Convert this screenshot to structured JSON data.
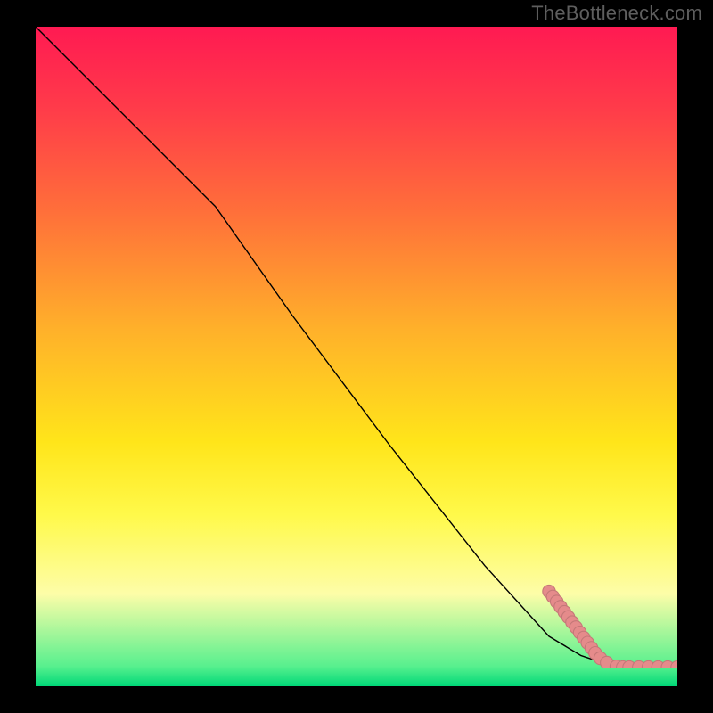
{
  "attribution": "TheBottleneck.com",
  "chart_data": {
    "type": "line",
    "title": "",
    "xlabel": "",
    "ylabel": "",
    "xlim": [
      0,
      100
    ],
    "ylim": [
      0,
      100
    ],
    "series": [
      {
        "name": "curve",
        "x": [
          0,
          10,
          20,
          28,
          40,
          55,
          70,
          80,
          85,
          88,
          92,
          96,
          100
        ],
        "y": [
          100,
          90,
          80,
          72,
          55,
          35,
          16,
          5,
          2,
          1,
          0.4,
          0.2,
          0.1
        ]
      }
    ],
    "points": [
      {
        "x": 80.0,
        "y": 12.0
      },
      {
        "x": 80.6,
        "y": 11.2
      },
      {
        "x": 81.2,
        "y": 10.4
      },
      {
        "x": 81.8,
        "y": 9.6
      },
      {
        "x": 82.4,
        "y": 8.8
      },
      {
        "x": 83.0,
        "y": 8.0
      },
      {
        "x": 83.6,
        "y": 7.2
      },
      {
        "x": 84.2,
        "y": 6.4
      },
      {
        "x": 84.8,
        "y": 5.6
      },
      {
        "x": 85.4,
        "y": 4.8
      },
      {
        "x": 86.0,
        "y": 4.0
      },
      {
        "x": 86.6,
        "y": 3.2
      },
      {
        "x": 87.2,
        "y": 2.4
      },
      {
        "x": 88.0,
        "y": 1.6
      },
      {
        "x": 89.0,
        "y": 0.9
      },
      {
        "x": 90.5,
        "y": 0.3
      },
      {
        "x": 91.5,
        "y": 0.2
      },
      {
        "x": 92.5,
        "y": 0.2
      },
      {
        "x": 94.0,
        "y": 0.2
      },
      {
        "x": 95.5,
        "y": 0.2
      },
      {
        "x": 97.0,
        "y": 0.2
      },
      {
        "x": 98.5,
        "y": 0.2
      },
      {
        "x": 100.0,
        "y": 0.2
      }
    ],
    "colors": {
      "line": "#000000",
      "point_fill": "#e58b8b",
      "point_stroke": "#c47878"
    }
  }
}
